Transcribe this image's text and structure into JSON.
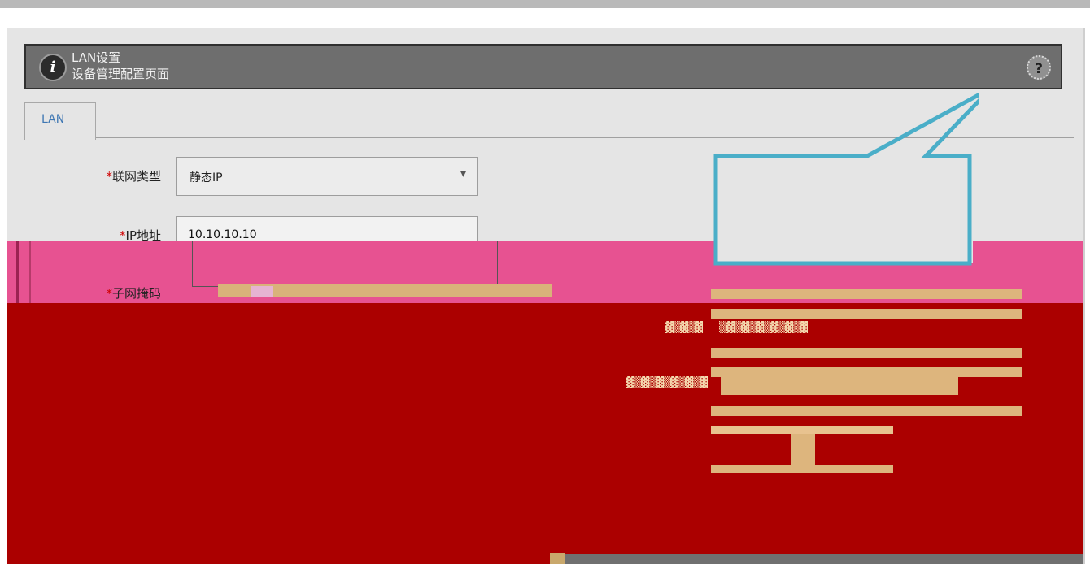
{
  "header": {
    "title": "LAN设置",
    "subtitle": "设备管理配置页面"
  },
  "tabs": [
    {
      "label": "LAN",
      "active": true
    }
  ],
  "form": {
    "network_type": {
      "label": "联网类型",
      "value": "静态IP"
    },
    "ip_address": {
      "label": "IP地址",
      "value": "10.10.10.10"
    },
    "subnet_mask": {
      "label": "子网掩码"
    }
  },
  "required_mark": "*",
  "icons": {
    "info": "i",
    "help": "?",
    "chevron": "▾"
  },
  "colors": {
    "header_bg": "#6e6e6e",
    "pink_band": "#e75291",
    "red_block": "#ab0000",
    "callout_border": "#4aaec8",
    "tab_text": "#3f77b3"
  }
}
